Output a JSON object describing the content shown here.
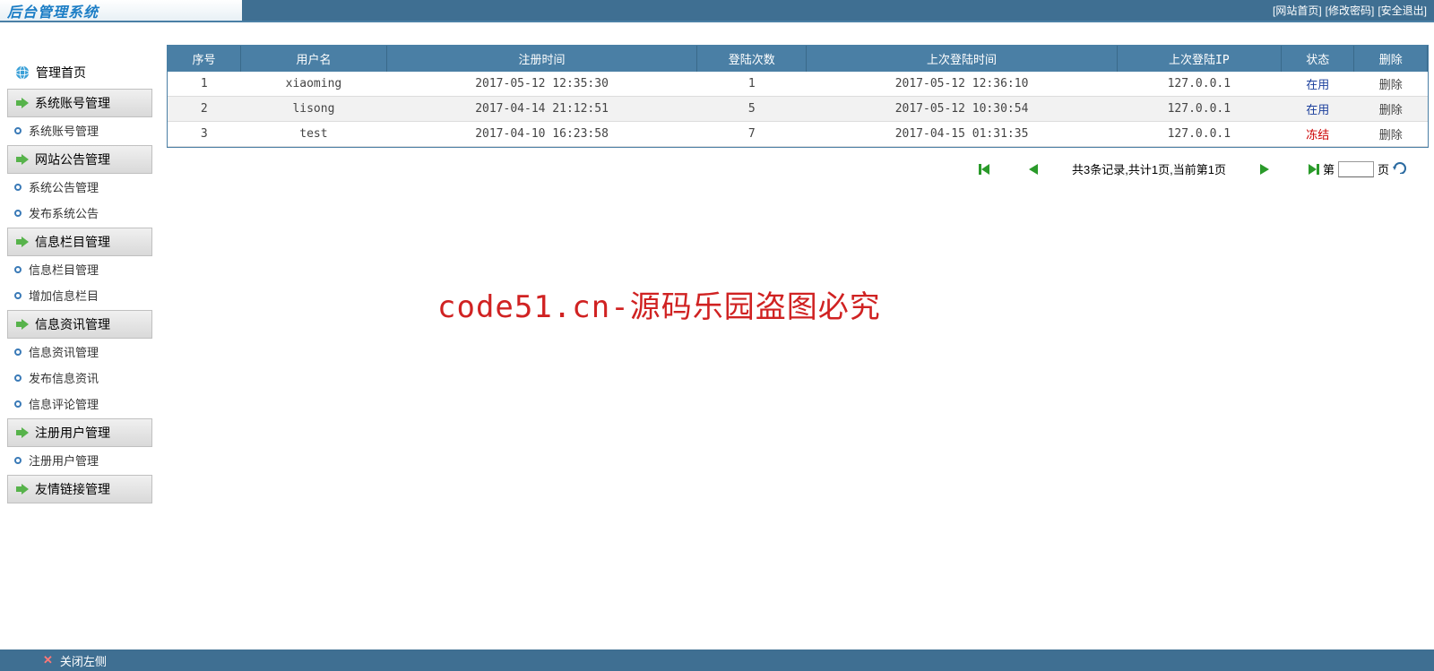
{
  "header": {
    "logo": "后台管理系统",
    "links": {
      "home": "[网站首页]",
      "pwd": "[修改密码]",
      "logout": "[安全退出]"
    }
  },
  "sidebar": {
    "home": "管理首页",
    "g1": {
      "title": "系统账号管理",
      "items": [
        "系统账号管理"
      ]
    },
    "g2": {
      "title": "网站公告管理",
      "items": [
        "系统公告管理",
        "发布系统公告"
      ]
    },
    "g3": {
      "title": "信息栏目管理",
      "items": [
        "信息栏目管理",
        "增加信息栏目"
      ]
    },
    "g4": {
      "title": "信息资讯管理",
      "items": [
        "信息资讯管理",
        "发布信息资讯",
        "信息评论管理"
      ]
    },
    "g5": {
      "title": "注册用户管理",
      "items": [
        "注册用户管理"
      ]
    },
    "g6": {
      "title": "友情链接管理",
      "items": []
    }
  },
  "table": {
    "headers": [
      "序号",
      "用户名",
      "注册时间",
      "登陆次数",
      "上次登陆时间",
      "上次登陆IP",
      "状态",
      "删除"
    ],
    "rows": [
      {
        "idx": "1",
        "user": "xiaoming",
        "reg": "2017-05-12 12:35:30",
        "count": "1",
        "last": "2017-05-12 12:36:10",
        "ip": "127.0.0.1",
        "status": "在用",
        "statusType": "active",
        "del": "删除"
      },
      {
        "idx": "2",
        "user": "lisong",
        "reg": "2017-04-14 21:12:51",
        "count": "5",
        "last": "2017-05-12 10:30:54",
        "ip": "127.0.0.1",
        "status": "在用",
        "statusType": "active",
        "del": "删除"
      },
      {
        "idx": "3",
        "user": "test",
        "reg": "2017-04-10 16:23:58",
        "count": "7",
        "last": "2017-04-15 01:31:35",
        "ip": "127.0.0.1",
        "status": "冻结",
        "statusType": "frozen",
        "del": "删除"
      }
    ]
  },
  "pager": {
    "info": "共3条记录,共计1页,当前第1页",
    "goto_prefix": "第",
    "goto_suffix": "页"
  },
  "watermark": "code51.cn-源码乐园盗图必究",
  "footer": {
    "close": "关闭左侧"
  }
}
